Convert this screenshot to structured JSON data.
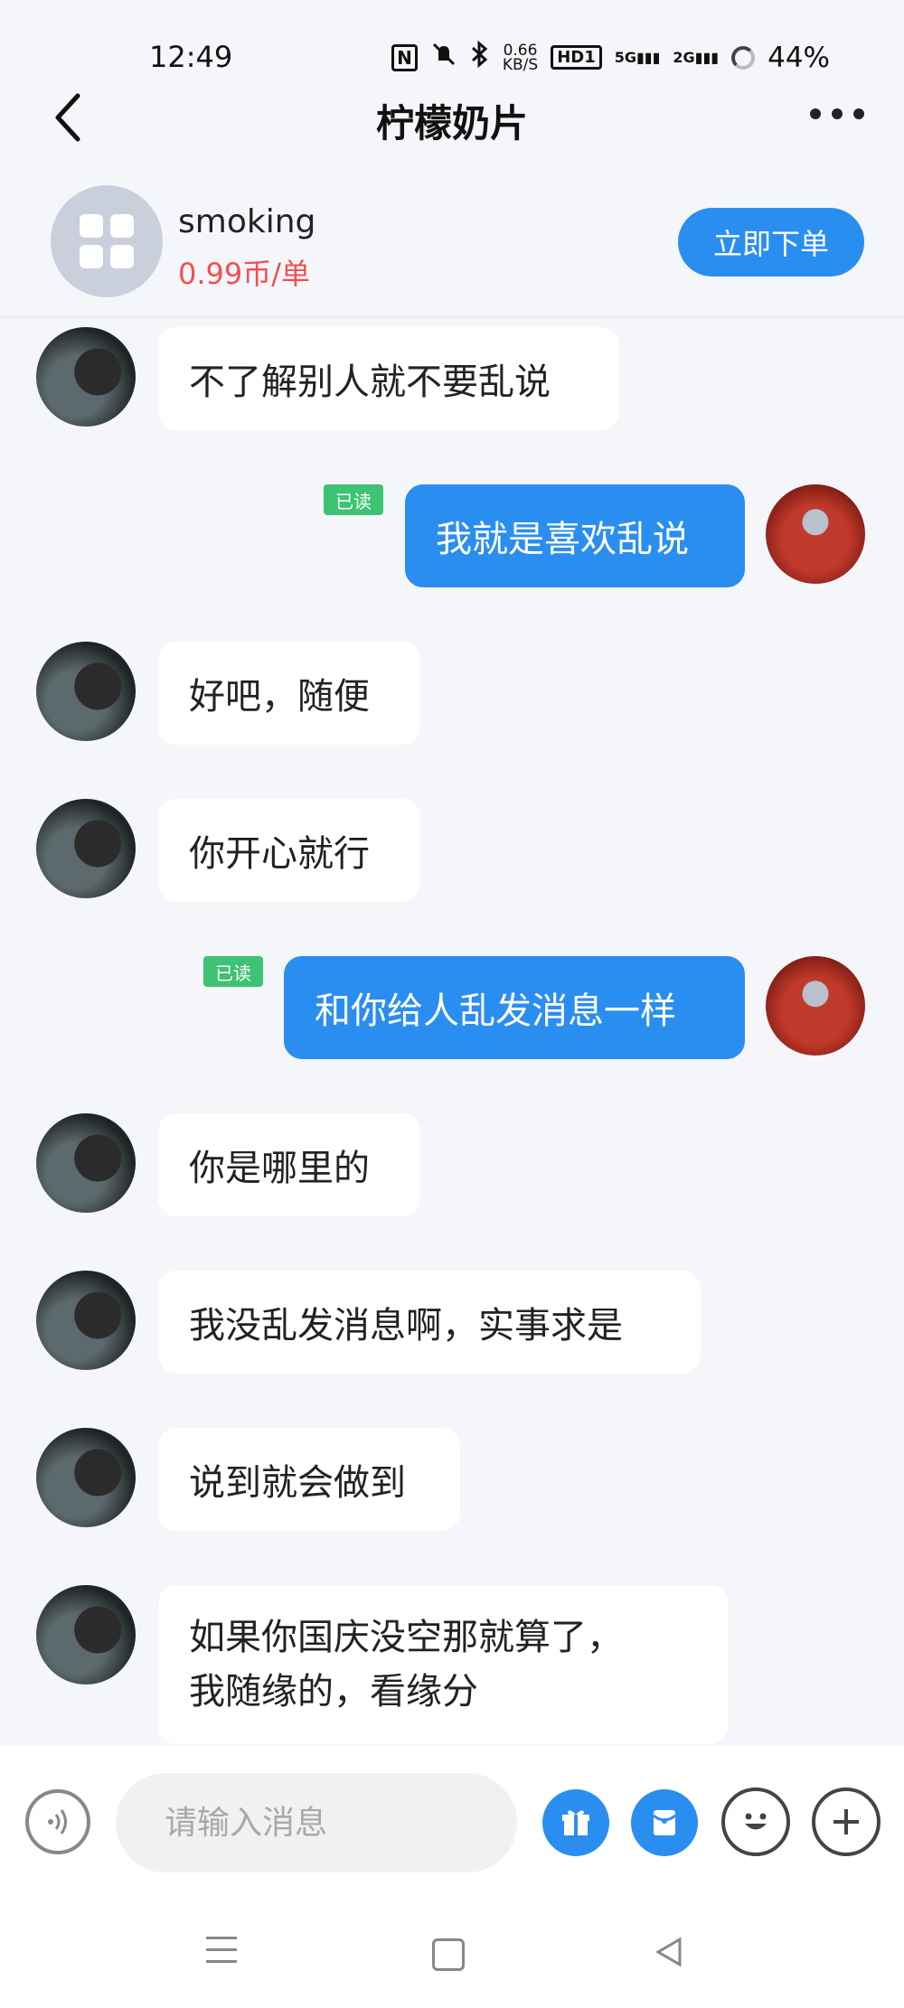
{
  "status_bar": {
    "time": "12:49",
    "net_speed": "0.66",
    "net_unit": "KB/S",
    "hd": "HD1",
    "sig1": "5G",
    "sig2": "2G",
    "battery": "44%",
    "icons": [
      "nfc-icon",
      "mute-icon",
      "bluetooth-icon",
      "hd-icon",
      "signal-icon",
      "battery-icon"
    ]
  },
  "header": {
    "title": "柠檬奶片",
    "back_icon": "chevron-left-icon",
    "more_icon": "more-icon"
  },
  "seller": {
    "name": "smoking",
    "price": "0.99币/单",
    "order_button": "立即下单"
  },
  "messages": [
    {
      "side": "left",
      "text": "不了解别人就不要乱说"
    },
    {
      "side": "right",
      "text": "我就是喜欢乱说",
      "status": "已读"
    },
    {
      "side": "left",
      "text": "好吧，随便"
    },
    {
      "side": "left",
      "text": "你开心就行"
    },
    {
      "side": "right",
      "text": "和你给人乱发消息一样",
      "status": "已读"
    },
    {
      "side": "left",
      "text": "你是哪里的"
    },
    {
      "side": "left",
      "text": "我没乱发消息啊，实事求是"
    },
    {
      "side": "left",
      "text": "说到就会做到"
    },
    {
      "side": "left",
      "lines": [
        "如果你国庆没空那就算了，",
        "我随缘的，看缘分"
      ]
    }
  ],
  "input": {
    "placeholder": "请输入消息",
    "icons": [
      "voice-icon",
      "gift-icon",
      "red-packet-icon",
      "emoji-icon",
      "plus-icon"
    ]
  },
  "colors": {
    "accent": "#2a8ef0",
    "read_tag": "#3dc373",
    "price": "#f0504f",
    "background": "#f4f6fa"
  }
}
